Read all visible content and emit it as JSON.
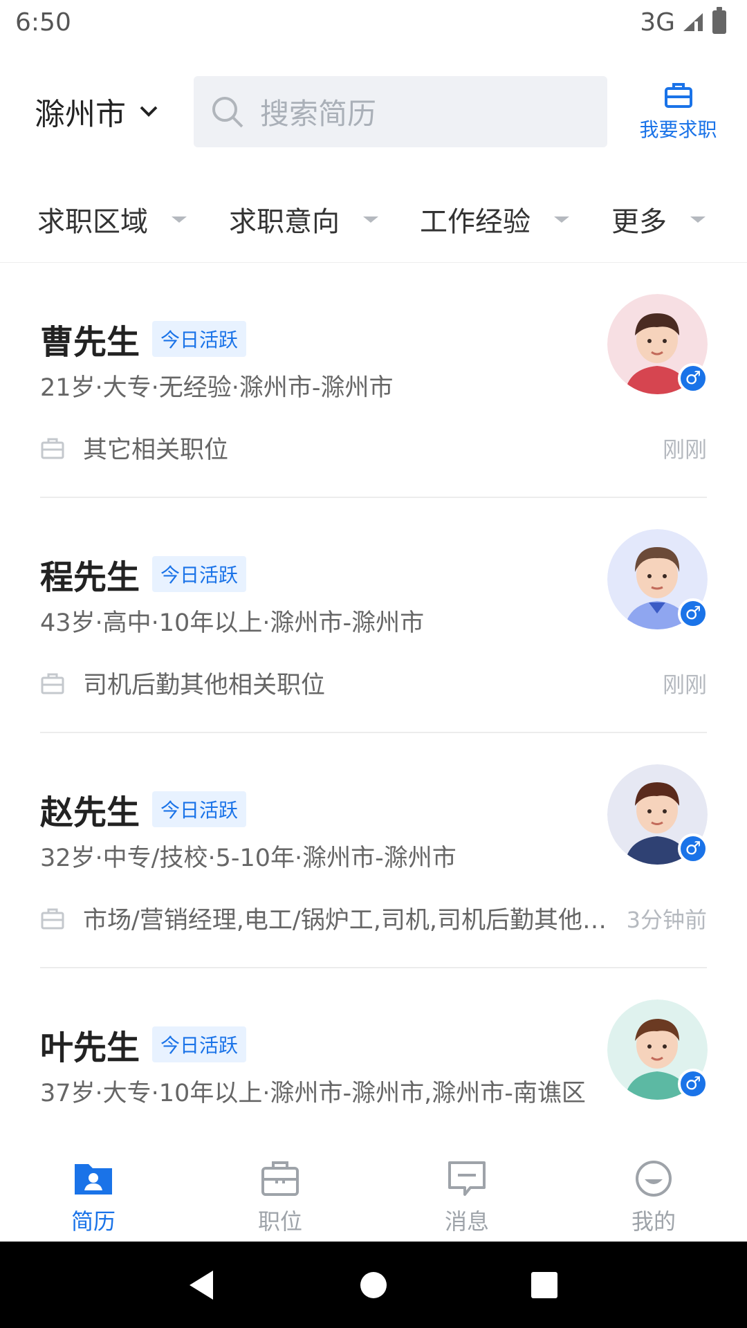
{
  "status_bar": {
    "time": "6:50",
    "network": "3G"
  },
  "header": {
    "city": "滁州市",
    "search_placeholder": "搜索简历",
    "job_seek_label": "我要求职"
  },
  "filters": [
    {
      "label": "求职区域"
    },
    {
      "label": "求职意向"
    },
    {
      "label": "工作经验"
    },
    {
      "label": "更多"
    }
  ],
  "resumes": [
    {
      "name": "曹先生",
      "badge": "今日活跃",
      "meta": "21岁·大专·无经验·滁州市-滁州市",
      "position": "其它相关职位",
      "time": "刚刚",
      "avatar_bg": "#f7dfe3",
      "shirt_color": "#d64550"
    },
    {
      "name": "程先生",
      "badge": "今日活跃",
      "meta": "43岁·高中·10年以上·滁州市-滁州市",
      "position": "司机后勤其他相关职位",
      "time": "刚刚",
      "avatar_bg": "#e3e8fb",
      "shirt_color": "#8fa6f0"
    },
    {
      "name": "赵先生",
      "badge": "今日活跃",
      "meta": "32岁·中专/技校·5-10年·滁州市-滁州市",
      "position": "市场/营销经理,电工/锅炉工,司机,司机后勤其他相关职位",
      "time": "3分钟前",
      "avatar_bg": "#e6e8f3",
      "shirt_color": "#2f4173"
    },
    {
      "name": "叶先生",
      "badge": "今日活跃",
      "meta": "37岁·大专·10年以上·滁州市-滁州市,滁州市-南谯区",
      "position": "",
      "time": "",
      "avatar_bg": "#dff2ee",
      "shirt_color": "#5cb9a3"
    }
  ],
  "bottom_nav": [
    {
      "label": "简历",
      "icon": "resume-icon",
      "active": true
    },
    {
      "label": "职位",
      "icon": "briefcase-icon",
      "active": false
    },
    {
      "label": "消息",
      "icon": "message-icon",
      "active": false
    },
    {
      "label": "我的",
      "icon": "profile-icon",
      "active": false
    }
  ],
  "colors": {
    "accent": "#1a73e8",
    "muted": "#9ea3a9"
  }
}
